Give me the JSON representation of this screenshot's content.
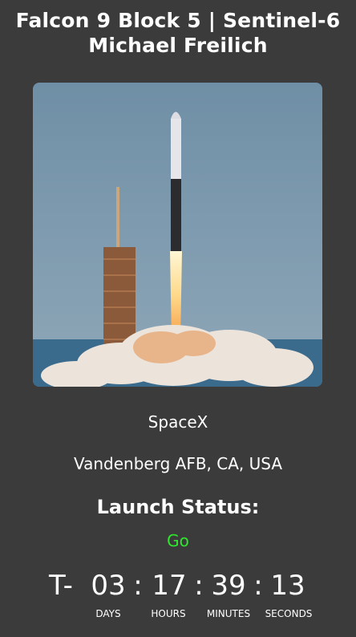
{
  "header": {
    "title": "Falcon 9 Block 5 | Sentinel-6 Michael Freilich"
  },
  "launch": {
    "provider": "SpaceX",
    "location": "Vandenberg AFB, CA, USA",
    "status_heading": "Launch Status:",
    "status_value": "Go",
    "status_color": "#2ee82e"
  },
  "countdown": {
    "prefix": "T-",
    "separator": ":",
    "days": "03",
    "hours": "17",
    "minutes": "39",
    "seconds": "13",
    "labels": {
      "days": "DAYS",
      "hours": "HOURS",
      "minutes": "MINUTES",
      "seconds": "SECONDS"
    }
  }
}
